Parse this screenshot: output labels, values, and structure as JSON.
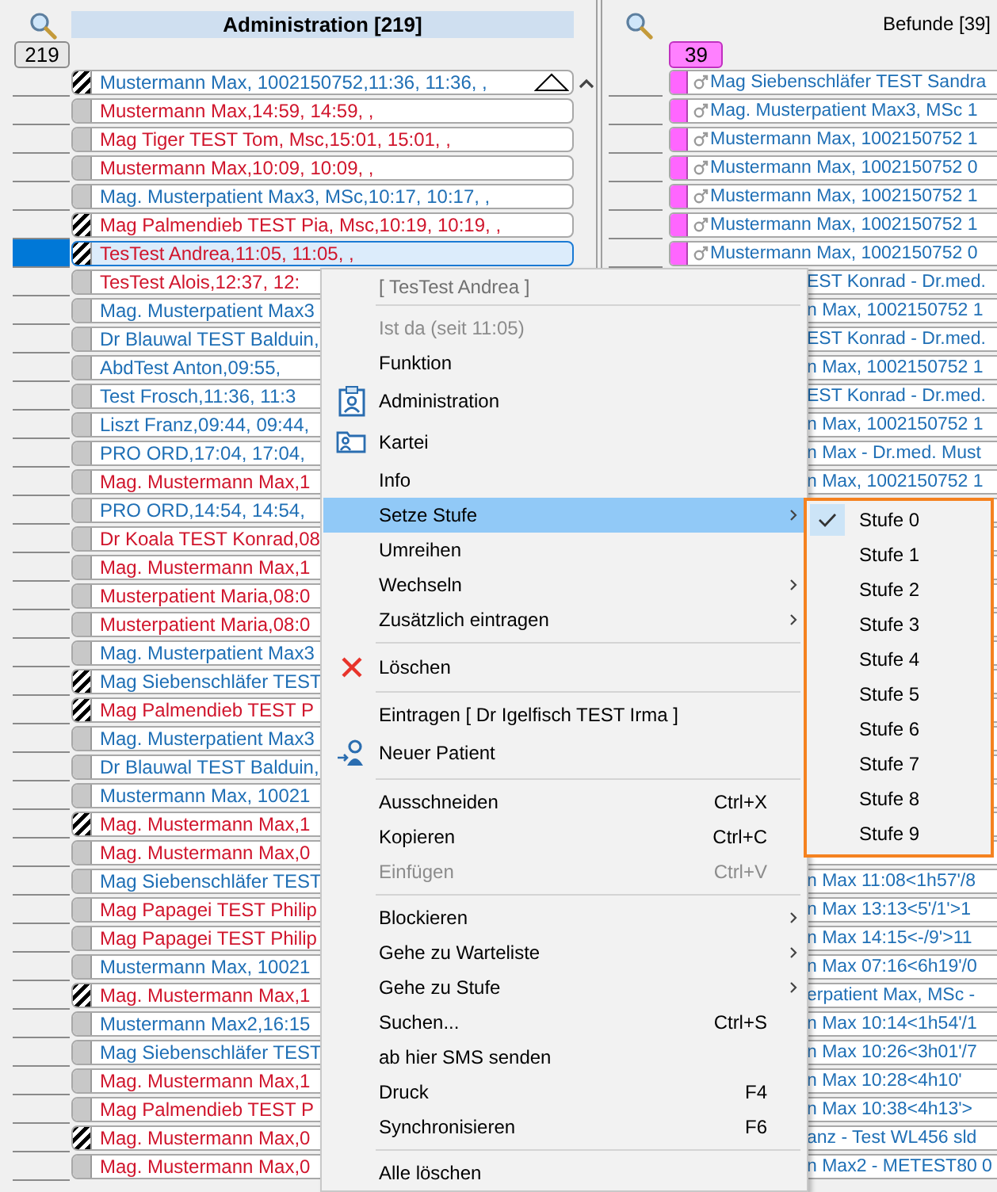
{
  "left_panel": {
    "title": "Administration [219]",
    "count": "219",
    "rows": [
      {
        "text": "Mustermann Max, 1002150752,11:36, 11:36, ,",
        "color": "#1f6fb5",
        "kind": "hatched",
        "selected": false
      },
      {
        "text": "Mustermann Max,14:59, 14:59, ,",
        "color": "#d0152c",
        "kind": "plain",
        "selected": false
      },
      {
        "text": "Mag Tiger TEST Tom, Msc,15:01, 15:01, ,",
        "color": "#d0152c",
        "kind": "plain",
        "selected": false
      },
      {
        "text": "Mustermann Max,10:09, 10:09, ,",
        "color": "#d0152c",
        "kind": "plain",
        "selected": false
      },
      {
        "text": "Mag. Musterpatient Max3, MSc,10:17, 10:17, ,",
        "color": "#1f6fb5",
        "kind": "plain",
        "selected": false
      },
      {
        "text": "Mag Palmendieb TEST Pia, Msc,10:19, 10:19, ,",
        "color": "#d0152c",
        "kind": "hatched",
        "selected": false
      },
      {
        "text": "TesTest Andrea,11:05, 11:05, ,",
        "color": "#d0152c",
        "kind": "hatched",
        "selected": true
      },
      {
        "text": "TesTest Alois,12:37, 12:",
        "color": "#d0152c",
        "kind": "plain",
        "selected": false
      },
      {
        "text": "Mag. Musterpatient Max3",
        "color": "#1f6fb5",
        "kind": "plain",
        "selected": false
      },
      {
        "text": "Dr Blauwal TEST Balduin,",
        "color": "#1f6fb5",
        "kind": "plain",
        "selected": false
      },
      {
        "text": "AbdTest Anton,09:55,",
        "color": "#1f6fb5",
        "kind": "plain",
        "selected": false
      },
      {
        "text": "Test Frosch,11:36, 11:3",
        "color": "#1f6fb5",
        "kind": "plain",
        "selected": false
      },
      {
        "text": "Liszt Franz,09:44, 09:44,",
        "color": "#1f6fb5",
        "kind": "plain",
        "selected": false
      },
      {
        "text": "PRO ORD,17:04, 17:04,",
        "color": "#1f6fb5",
        "kind": "plain",
        "selected": false
      },
      {
        "text": "Mag. Mustermann Max,1",
        "color": "#d0152c",
        "kind": "plain",
        "selected": false
      },
      {
        "text": "PRO ORD,14:54, 14:54,",
        "color": "#1f6fb5",
        "kind": "plain",
        "selected": false
      },
      {
        "text": "Dr Koala TEST Konrad,08",
        "color": "#d0152c",
        "kind": "plain",
        "selected": false
      },
      {
        "text": "Mag. Mustermann Max,1",
        "color": "#d0152c",
        "kind": "plain",
        "selected": false
      },
      {
        "text": "Musterpatient Maria,08:0",
        "color": "#d0152c",
        "kind": "plain",
        "selected": false
      },
      {
        "text": "Musterpatient Maria,08:0",
        "color": "#d0152c",
        "kind": "plain",
        "selected": false
      },
      {
        "text": "Mag. Musterpatient Max3",
        "color": "#1f6fb5",
        "kind": "plain",
        "selected": false
      },
      {
        "text": "Mag Siebenschläfer TEST",
        "color": "#1f6fb5",
        "kind": "hatched",
        "selected": false
      },
      {
        "text": "Mag Palmendieb TEST P",
        "color": "#d0152c",
        "kind": "hatched",
        "selected": false
      },
      {
        "text": "Mag. Musterpatient Max3",
        "color": "#1f6fb5",
        "kind": "plain",
        "selected": false
      },
      {
        "text": "Dr Blauwal TEST Balduin,",
        "color": "#1f6fb5",
        "kind": "plain",
        "selected": false
      },
      {
        "text": "Mustermann Max, 10021",
        "color": "#1f6fb5",
        "kind": "plain",
        "selected": false
      },
      {
        "text": "Mag. Mustermann Max,1",
        "color": "#d0152c",
        "kind": "hatched",
        "selected": false
      },
      {
        "text": "Mag. Mustermann Max,0",
        "color": "#d0152c",
        "kind": "plain",
        "selected": false
      },
      {
        "text": "Mag Siebenschläfer TEST",
        "color": "#1f6fb5",
        "kind": "plain",
        "selected": false
      },
      {
        "text": "Mag Papagei TEST Philip",
        "color": "#d0152c",
        "kind": "plain",
        "selected": false
      },
      {
        "text": "Mag Papagei TEST Philip",
        "color": "#d0152c",
        "kind": "plain",
        "selected": false
      },
      {
        "text": "Mustermann Max, 10021",
        "color": "#1f6fb5",
        "kind": "plain",
        "selected": false
      },
      {
        "text": "Mag. Mustermann Max,1",
        "color": "#d0152c",
        "kind": "hatched",
        "selected": false
      },
      {
        "text": "Mustermann Max2,16:15",
        "color": "#1f6fb5",
        "kind": "plain",
        "selected": false
      },
      {
        "text": "Mag Siebenschläfer TEST",
        "color": "#1f6fb5",
        "kind": "plain",
        "selected": false
      },
      {
        "text": "Mag. Mustermann Max,1",
        "color": "#d0152c",
        "kind": "plain",
        "selected": false
      },
      {
        "text": "Mag Palmendieb TEST P",
        "color": "#d0152c",
        "kind": "plain",
        "selected": false
      },
      {
        "text": "Mag. Mustermann Max,0",
        "color": "#d0152c",
        "kind": "hatched",
        "selected": false
      },
      {
        "text": "Mag. Mustermann Max,0",
        "color": "#d0152c",
        "kind": "plain",
        "selected": false
      }
    ]
  },
  "right_panel": {
    "title": "Befunde [39]",
    "count": "39",
    "rows_top": [
      {
        "text": "Mag Siebenschläfer TEST Sandra"
      },
      {
        "text": "Mag. Musterpatient Max3, MSc 1"
      },
      {
        "text": "Mustermann Max, 1002150752 1"
      },
      {
        "text": "Mustermann Max, 1002150752 0"
      },
      {
        "text": "Mustermann Max, 1002150752 1"
      },
      {
        "text": "Mustermann Max, 1002150752 1"
      },
      {
        "text": "Mustermann Max, 1002150752 0"
      },
      {
        "text": "EST Konrad - Dr.med."
      },
      {
        "text": "n Max, 1002150752 1"
      },
      {
        "text": "EST Konrad - Dr.med."
      },
      {
        "text": "n Max, 1002150752 1"
      },
      {
        "text": "EST Konrad - Dr.med."
      },
      {
        "text": "n Max, 1002150752 1"
      },
      {
        "text": "n Max - Dr.med. Must"
      },
      {
        "text": "n Max, 1002150752 1"
      }
    ],
    "rows_bottom": [
      {
        "text": "n Max 11:08<1h57'/8"
      },
      {
        "text": "n Max 13:13<5'/1'>1"
      },
      {
        "text": "n Max 14:15<-/9'>11"
      },
      {
        "text": "n Max 07:16<6h19'/0"
      },
      {
        "text": "erpatient Max, MSc -"
      },
      {
        "text": "n Max 10:14<1h54'/1"
      },
      {
        "text": "n Max 10:26<3h01'/7"
      },
      {
        "text": "n Max 10:28<4h10'"
      },
      {
        "text": "n Max 10:38<4h13'>"
      },
      {
        "text": "anz - Test WL456 sld"
      },
      {
        "text": "n Max2 - METEST80 0"
      }
    ]
  },
  "context_menu": {
    "items": [
      {
        "kind": "header",
        "label": "[ TesTest Andrea ]"
      },
      {
        "kind": "separator"
      },
      {
        "kind": "item",
        "label": "Ist da (seit 11:05)",
        "disabled": true,
        "selected": false,
        "submenu": false
      },
      {
        "kind": "item",
        "label": "Funktion",
        "disabled": false,
        "selected": false,
        "submenu": false
      },
      {
        "kind": "item",
        "label": "Administration",
        "disabled": false,
        "selected": false,
        "submenu": false
      },
      {
        "kind": "item",
        "label": "Kartei",
        "disabled": false,
        "selected": false,
        "submenu": false
      },
      {
        "kind": "item",
        "label": "Info",
        "disabled": false,
        "selected": false,
        "submenu": false
      },
      {
        "kind": "item",
        "label": "Setze Stufe",
        "disabled": false,
        "selected": true,
        "submenu": true
      },
      {
        "kind": "item",
        "label": "Umreihen",
        "disabled": false,
        "selected": false,
        "submenu": false
      },
      {
        "kind": "item",
        "label": "Wechseln",
        "disabled": false,
        "selected": false,
        "submenu": true
      },
      {
        "kind": "item",
        "label": "Zusätzlich eintragen",
        "disabled": false,
        "selected": false,
        "submenu": true
      },
      {
        "kind": "separator"
      },
      {
        "kind": "item",
        "label": "Löschen",
        "disabled": false,
        "selected": false,
        "submenu": false
      },
      {
        "kind": "separator"
      },
      {
        "kind": "item",
        "label": "Eintragen [ Dr Igelfisch TEST Irma ]",
        "disabled": false,
        "selected": false,
        "submenu": false
      },
      {
        "kind": "item",
        "label": "Neuer Patient",
        "disabled": false,
        "selected": false,
        "submenu": false
      },
      {
        "kind": "separator"
      },
      {
        "kind": "item",
        "label": "Ausschneiden",
        "shortcut": "Ctrl+X",
        "disabled": false,
        "selected": false,
        "submenu": false
      },
      {
        "kind": "item",
        "label": "Kopieren",
        "shortcut": "Ctrl+C",
        "disabled": false,
        "selected": false,
        "submenu": false
      },
      {
        "kind": "item",
        "label": "Einfügen",
        "shortcut": "Ctrl+V",
        "disabled": true,
        "selected": false,
        "submenu": false
      },
      {
        "kind": "separator"
      },
      {
        "kind": "item",
        "label": "Blockieren",
        "disabled": false,
        "selected": false,
        "submenu": true
      },
      {
        "kind": "item",
        "label": "Gehe zu Warteliste",
        "disabled": false,
        "selected": false,
        "submenu": true
      },
      {
        "kind": "item",
        "label": "Gehe zu Stufe",
        "disabled": false,
        "selected": false,
        "submenu": true
      },
      {
        "kind": "item",
        "label": "Suchen...",
        "shortcut": "Ctrl+S",
        "disabled": false,
        "selected": false,
        "submenu": false
      },
      {
        "kind": "item",
        "label": "ab hier SMS senden",
        "disabled": false,
        "selected": false,
        "submenu": false
      },
      {
        "kind": "item",
        "label": "Druck",
        "shortcut": "F4",
        "disabled": false,
        "selected": false,
        "submenu": false
      },
      {
        "kind": "item",
        "label": "Synchronisieren",
        "shortcut": "F6",
        "disabled": false,
        "selected": false,
        "submenu": false
      },
      {
        "kind": "separator"
      },
      {
        "kind": "item",
        "label": "Alle löschen",
        "disabled": false,
        "selected": false,
        "submenu": false
      }
    ]
  },
  "stufe_menu": {
    "items": [
      {
        "label": "Stufe 0",
        "checked": true
      },
      {
        "label": "Stufe 1",
        "checked": false
      },
      {
        "label": "Stufe 2",
        "checked": false
      },
      {
        "label": "Stufe 3",
        "checked": false
      },
      {
        "label": "Stufe 4",
        "checked": false
      },
      {
        "label": "Stufe 5",
        "checked": false
      },
      {
        "label": "Stufe 6",
        "checked": false
      },
      {
        "label": "Stufe 7",
        "checked": false
      },
      {
        "label": "Stufe 8",
        "checked": false
      },
      {
        "label": "Stufe 9",
        "checked": false
      }
    ]
  }
}
